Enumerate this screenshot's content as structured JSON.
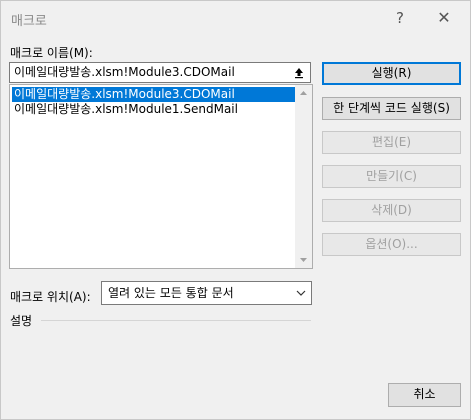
{
  "window": {
    "title": "매크로",
    "help": "?",
    "close": "✕"
  },
  "macro_name": {
    "label": "매크로 이름(M):",
    "value": "이메일대량발송.xlsm!Module3.CDOMail"
  },
  "macro_list": [
    {
      "text": "이메일대량발송.xlsm!Module3.CDOMail",
      "selected": true
    },
    {
      "text": "이메일대량발송.xlsm!Module1.SendMail",
      "selected": false
    }
  ],
  "buttons": {
    "run": "실행(R)",
    "step_into": "한 단계씩 코드 실행(S)",
    "edit": "편집(E)",
    "create": "만들기(C)",
    "delete": "삭제(D)",
    "options": "옵션(O)...",
    "cancel": "취소"
  },
  "location": {
    "label": "매크로 위치(A):",
    "selected": "열려 있는 모든 통합 문서"
  },
  "description": {
    "label": "설명"
  },
  "colors": {
    "accent": "#0078d7"
  }
}
